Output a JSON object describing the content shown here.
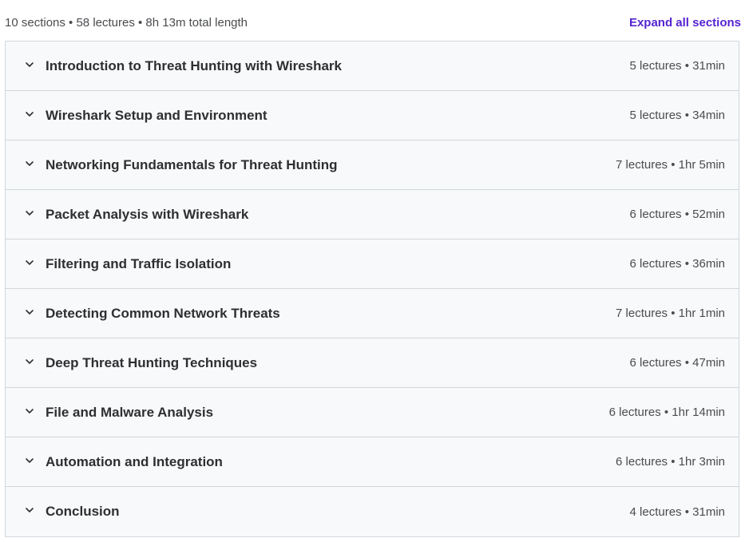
{
  "summary": {
    "text": "10 sections • 58 lectures • 8h 13m total length",
    "expand_label": "Expand all sections"
  },
  "colors": {
    "accent": "#5624d0",
    "row_background": "#f7f9fa",
    "border": "#d1d7dc",
    "text": "#2d2f31"
  },
  "sections": [
    {
      "title": "Introduction to Threat Hunting with Wireshark",
      "meta": "5 lectures • 31min",
      "icon": "chevron-down-icon"
    },
    {
      "title": "Wireshark Setup and Environment",
      "meta": "5 lectures • 34min",
      "icon": "chevron-down-icon"
    },
    {
      "title": "Networking Fundamentals for Threat Hunting",
      "meta": "7 lectures • 1hr 5min",
      "icon": "chevron-down-icon"
    },
    {
      "title": "Packet Analysis with Wireshark",
      "meta": "6 lectures • 52min",
      "icon": "chevron-down-icon"
    },
    {
      "title": "Filtering and Traffic Isolation",
      "meta": "6 lectures • 36min",
      "icon": "chevron-down-icon"
    },
    {
      "title": "Detecting Common Network Threats",
      "meta": "7 lectures • 1hr 1min",
      "icon": "chevron-down-icon"
    },
    {
      "title": "Deep Threat Hunting Techniques",
      "meta": "6 lectures • 47min",
      "icon": "chevron-down-icon"
    },
    {
      "title": "File and Malware Analysis",
      "meta": "6 lectures • 1hr 14min",
      "icon": "chevron-down-icon"
    },
    {
      "title": "Automation and Integration",
      "meta": "6 lectures • 1hr 3min",
      "icon": "chevron-down-icon"
    },
    {
      "title": "Conclusion",
      "meta": "4 lectures • 31min",
      "icon": "chevron-down-icon"
    }
  ]
}
